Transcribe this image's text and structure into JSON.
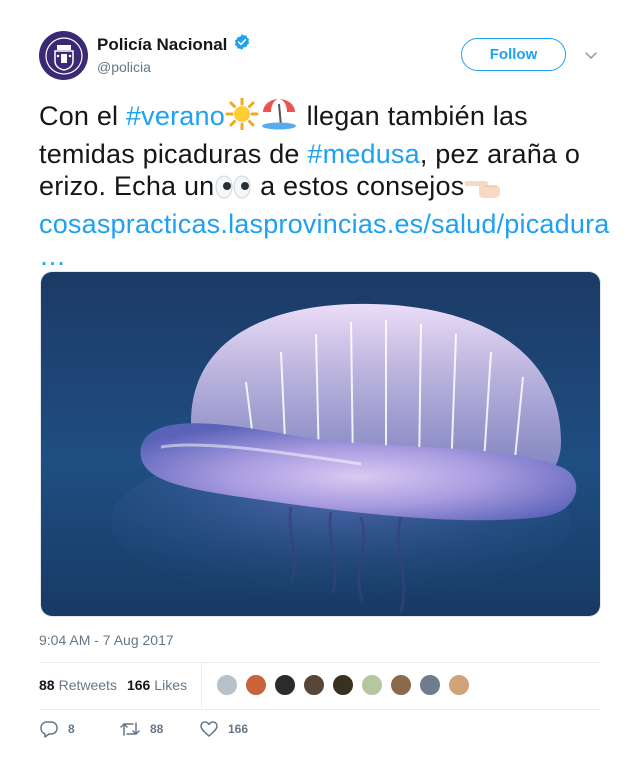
{
  "author": {
    "name": "Policía Nacional",
    "handle": "@policia",
    "verified": true
  },
  "follow_label": "Follow",
  "tweet": {
    "segments": [
      {
        "text": "Con el ",
        "type": "text"
      },
      {
        "text": "#verano",
        "type": "hashtag"
      },
      {
        "emoji": "sun",
        "type": "emoji"
      },
      {
        "emoji": "beach-umbrella",
        "type": "emoji"
      },
      {
        "text": " llegan también las temidas picaduras de ",
        "type": "text"
      },
      {
        "text": "#medusa",
        "type": "hashtag"
      },
      {
        "text": ", pez araña o erizo. Echa un",
        "type": "text"
      },
      {
        "emoji": "eyes",
        "type": "emoji"
      },
      {
        "text": " a estos consejos",
        "type": "text"
      },
      {
        "emoji": "pointing-left",
        "type": "emoji"
      },
      {
        "text": " cosaspracticas.lasprovincias.es/salud/picadura …",
        "type": "link"
      }
    ]
  },
  "timestamp": "9:04 AM - 7 Aug 2017",
  "stats": {
    "retweets_count": "88",
    "retweets_label": "Retweets",
    "likes_count": "166",
    "likes_label": "Likes"
  },
  "actions": {
    "reply_count": "8",
    "retweet_count": "88",
    "like_count": "166"
  },
  "colors": {
    "accent": "#1da1f2",
    "text": "#14171a",
    "muted": "#657786"
  }
}
